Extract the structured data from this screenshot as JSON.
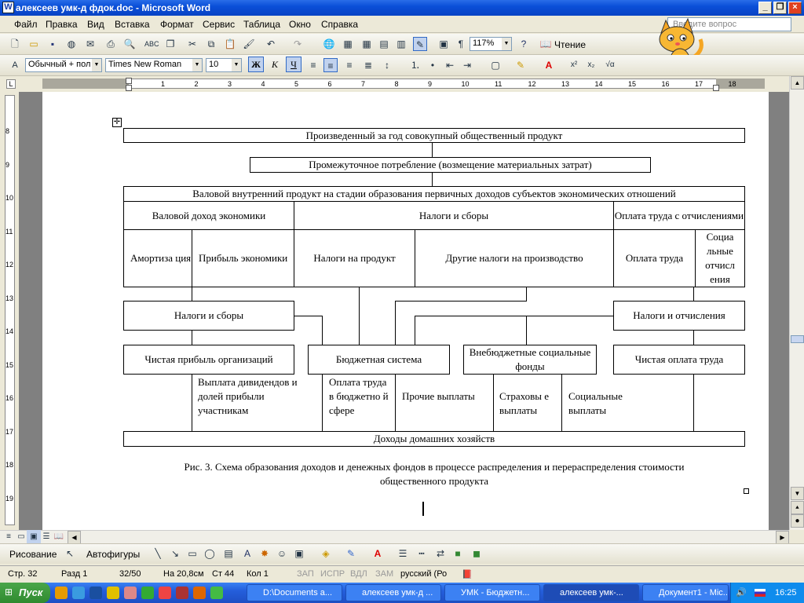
{
  "window": {
    "title": "алексеев умк-д  фдок.doc - Microsoft Word",
    "app_icon": "W"
  },
  "menu": [
    "Файл",
    "Правка",
    "Вид",
    "Вставка",
    "Формат",
    "Сервис",
    "Таблица",
    "Окно",
    "Справка"
  ],
  "ask_placeholder": "Введите вопрос",
  "toolbar": {
    "zoom": "117%",
    "read_label": "Чтение"
  },
  "format": {
    "style": "Обычный + пол",
    "font": "Times New Roman",
    "size": "10",
    "bold": "Ж",
    "italic": "К",
    "underline": "Ч"
  },
  "ruler_numbers": [
    "1",
    "2",
    "3",
    "4",
    "5",
    "6",
    "7",
    "8",
    "9",
    "10",
    "11",
    "12",
    "13",
    "14",
    "15",
    "16",
    "17",
    "18"
  ],
  "vruler_numbers": [
    "8",
    "9",
    "10",
    "11",
    "12",
    "13",
    "14",
    "15",
    "16",
    "17",
    "18",
    "19"
  ],
  "diagram": {
    "top": "Произведенный за год совокупный общественный продукт",
    "intermediate": "Промежуточное потребление (возмещение материальных затрат)",
    "gdp": "Валовой внутренний продукт на стадии образования первичных доходов субъектов экономических отношений",
    "gross_income": "Валовой доход экономики",
    "taxes_fees": "Налоги и сборы",
    "labor_pay": "Оплата труда с отчислениями",
    "amortization": "Амортиза ция",
    "profit": "Прибыль экономики",
    "product_taxes": "Налоги на продукт",
    "other_taxes": "Другие налоги на производство",
    "pay": "Оплата труда",
    "social_contrib": "Социа льные отчисл ения",
    "taxes_left": "Налоги и сборы",
    "taxes_right": "Налоги и отчисления",
    "net_profit": "Чистая прибыль организаций",
    "budget": "Бюджетная система",
    "offbudget": "Внебюджетные социальные фонды",
    "net_pay": "Чистая оплата труда",
    "dividends": "Выплата дивидендов и долей прибыли участникам",
    "budget_pay": "Оплата труда в бюджетно й сфере",
    "other_pay": "Прочие выплаты",
    "insurance": "Страховы е выплаты",
    "social_pay": "Социальные выплаты",
    "household": "Доходы домашних хозяйств",
    "caption1": "Рис. 3.  Схема образования доходов и денежных фондов в процессе распределения и перераспределения  стоимости",
    "caption2": "общественного продукта"
  },
  "drawing": {
    "draw_label": "Рисование",
    "autoshapes_label": "Автофигуры"
  },
  "status": {
    "page": "Стр.  32",
    "section": "Разд  1",
    "pages": "32/50",
    "at": "На  20,8см",
    "line": "Ст  44",
    "col": "Кол  1",
    "rec": "ЗАП",
    "trk": "ИСПР",
    "ext": "ВДЛ",
    "ovr": "ЗАМ",
    "lang": "русский (Ро"
  },
  "taskbar": {
    "start": "Пуск",
    "tasks": [
      "D:\\Documents a...",
      "алексеев умк-д ...",
      "УМК - Бюджетн...",
      "алексеев умк-...",
      "Документ1 - Mic..."
    ],
    "time": "16:25"
  },
  "colors": {
    "title_bar": "#0a4fd8",
    "taskbar": "#245edb",
    "start": "#2f8a2f"
  }
}
